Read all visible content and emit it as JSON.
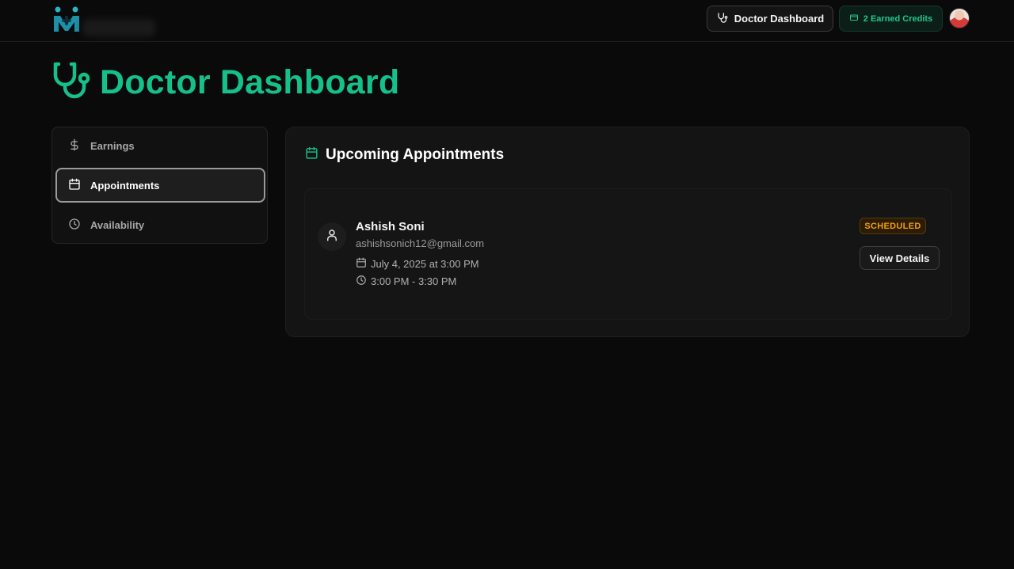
{
  "header": {
    "nav_button_label": "Doctor Dashboard",
    "credits_label": "2 Earned Credits"
  },
  "page": {
    "title": "Doctor Dashboard"
  },
  "sidebar": {
    "items": [
      {
        "label": "Earnings",
        "icon": "dollar-icon",
        "active": false
      },
      {
        "label": "Appointments",
        "icon": "calendar-icon",
        "active": true
      },
      {
        "label": "Availability",
        "icon": "clock-icon",
        "active": false
      }
    ]
  },
  "main": {
    "section_title": "Upcoming Appointments",
    "appointments": [
      {
        "patient_name": "Ashish Soni",
        "patient_email": "ashishsonich12@gmail.com",
        "date_text": "July 4, 2025 at 3:00 PM",
        "time_text": "3:00 PM - 3:30 PM",
        "status": "SCHEDULED",
        "action_label": "View Details"
      }
    ]
  },
  "colors": {
    "accent": "#16c08a",
    "background": "#0a0a0a",
    "status_scheduled": "#f59e0b"
  }
}
